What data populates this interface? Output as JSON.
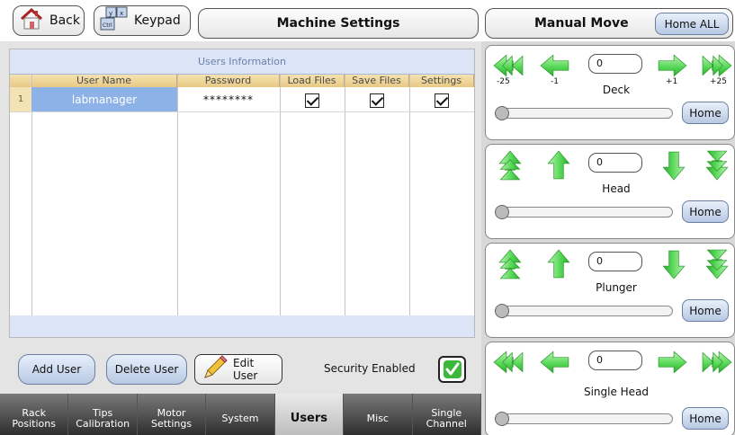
{
  "toolbar": {
    "back_label": "Back",
    "keypad_label": "Keypad"
  },
  "titles": {
    "machine_settings": "Machine Settings",
    "manual_move": "Manual Move",
    "home_all": "Home ALL"
  },
  "users_table": {
    "caption": "Users Information",
    "columns": [
      "User Name",
      "Password",
      "Load Files",
      "Save Files",
      "Settings"
    ],
    "rows": [
      {
        "num": "1",
        "user": "labmanager",
        "password": "********",
        "load": true,
        "save": true,
        "settings": true
      }
    ]
  },
  "actions": {
    "add_user": "Add User",
    "delete_user": "Delete User",
    "edit_user": "Edit User",
    "security_label": "Security Enabled",
    "security_enabled": true
  },
  "tabs": [
    {
      "label": "Rack Positions",
      "active": false
    },
    {
      "label": "Tips Calibration",
      "active": false
    },
    {
      "label": "Motor Settings",
      "active": false
    },
    {
      "label": "System",
      "active": false
    },
    {
      "label": "Users",
      "active": true
    },
    {
      "label": "Misc",
      "active": false
    },
    {
      "label": "Single Channel",
      "active": false
    }
  ],
  "axes": {
    "deck": {
      "label": "Deck",
      "value": "0",
      "home": "Home",
      "step_labels": [
        "-25",
        "-1",
        "+1",
        "+25"
      ]
    },
    "head": {
      "label": "Head",
      "value": "0",
      "home": "Home"
    },
    "plunger": {
      "label": "Plunger",
      "value": "0",
      "home": "Home"
    },
    "single_head": {
      "label": "Single Head",
      "value": "0",
      "home": "Home"
    }
  },
  "colors": {
    "arrow_green": "#52d652",
    "grid_header": "#e8c984",
    "selected_row": "#8cb2e8"
  },
  "icons": [
    "house-icon",
    "keypad-icon",
    "pencil-icon",
    "checkmark-icon",
    "arrow-left-icon",
    "arrow-left-double-icon",
    "arrow-right-icon",
    "arrow-right-double-icon",
    "arrow-up-icon",
    "arrow-down-icon",
    "arrow-up-double-icon",
    "arrow-down-double-icon"
  ]
}
